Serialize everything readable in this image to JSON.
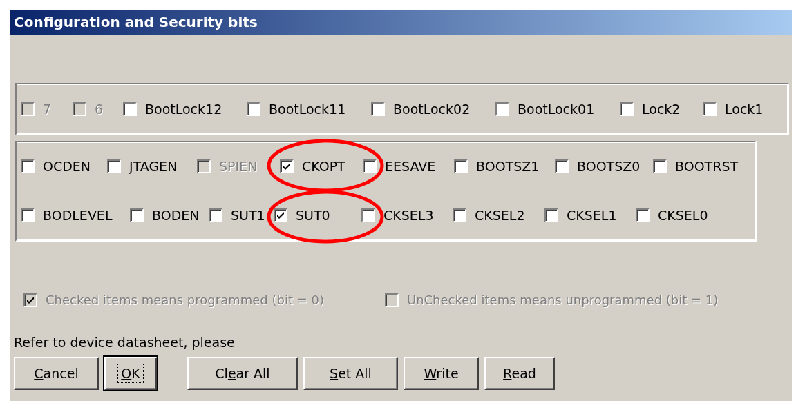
{
  "window": {
    "title": "Configuration and Security bits"
  },
  "lock_bits": [
    {
      "label": "7",
      "checked": false,
      "disabled": true
    },
    {
      "label": "6",
      "checked": false,
      "disabled": true
    },
    {
      "label": "BootLock12",
      "checked": false,
      "disabled": false
    },
    {
      "label": "BootLock11",
      "checked": false,
      "disabled": false
    },
    {
      "label": "BootLock02",
      "checked": false,
      "disabled": false
    },
    {
      "label": "BootLock01",
      "checked": false,
      "disabled": false
    },
    {
      "label": "Lock2",
      "checked": false,
      "disabled": false
    },
    {
      "label": "Lock1",
      "checked": false,
      "disabled": false
    }
  ],
  "fuse_rows": [
    [
      {
        "label": "OCDEN",
        "checked": false,
        "disabled": false
      },
      {
        "label": "JTAGEN",
        "checked": false,
        "disabled": false
      },
      {
        "label": "SPIEN",
        "checked": false,
        "disabled": true
      },
      {
        "label": "CKOPT",
        "checked": true,
        "disabled": false
      },
      {
        "label": "EESAVE",
        "checked": false,
        "disabled": false
      },
      {
        "label": "BOOTSZ1",
        "checked": false,
        "disabled": false
      },
      {
        "label": "BOOTSZ0",
        "checked": false,
        "disabled": false
      },
      {
        "label": "BOOTRST",
        "checked": false,
        "disabled": false
      }
    ],
    [
      {
        "label": "BODLEVEL",
        "checked": false,
        "disabled": false
      },
      {
        "label": "BODEN",
        "checked": false,
        "disabled": false
      },
      {
        "label": "SUT1",
        "checked": false,
        "disabled": false
      },
      {
        "label": "SUT0",
        "checked": true,
        "disabled": false
      },
      {
        "label": "CKSEL3",
        "checked": false,
        "disabled": false
      },
      {
        "label": "CKSEL2",
        "checked": false,
        "disabled": false
      },
      {
        "label": "CKSEL1",
        "checked": false,
        "disabled": false
      },
      {
        "label": "CKSEL0",
        "checked": false,
        "disabled": false
      }
    ]
  ],
  "annotations": [
    {
      "kind": "ellipse"
    },
    {
      "kind": "ellipse"
    }
  ],
  "legend": [
    {
      "label": "Checked items means programmed (bit = 0)",
      "checked": true,
      "disabled": true
    },
    {
      "label": "UnChecked items means unprogrammed (bit = 1)",
      "checked": false,
      "disabled": true
    }
  ],
  "note": "Refer to device datasheet, please",
  "buttons": [
    {
      "key": "C",
      "after": "ancel",
      "focused": false
    },
    {
      "key": "O",
      "after": "K",
      "focused": true
    },
    {
      "before": "Cl",
      "key": "e",
      "after": "ar All",
      "focused": false
    },
    {
      "key": "S",
      "after": "et All",
      "focused": false
    },
    {
      "key": "W",
      "after": "rite",
      "focused": false
    },
    {
      "key": "R",
      "after": "ead",
      "focused": false
    }
  ]
}
